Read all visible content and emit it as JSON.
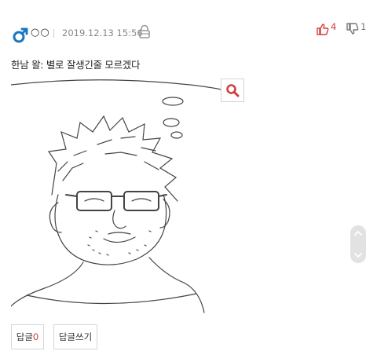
{
  "post": {
    "nickname": "○○",
    "date": "2019.12.13 15:56",
    "likes": "4",
    "dislikes": "1",
    "text": "한남 왈: 별로 잘생긴줄 모르겠다"
  },
  "actions": {
    "reply_label": "답글",
    "reply_count": "0",
    "write_reply_label": "답글쓰기"
  },
  "colors": {
    "gender_icon": "#1a78c2",
    "like": "#d23b3b",
    "dislike": "#777777"
  },
  "icons": [
    "male-gender-icon",
    "lock-icon",
    "thumbs-up-icon",
    "thumbs-down-icon",
    "search-icon",
    "chevron-up-icon",
    "chevron-down-icon"
  ]
}
